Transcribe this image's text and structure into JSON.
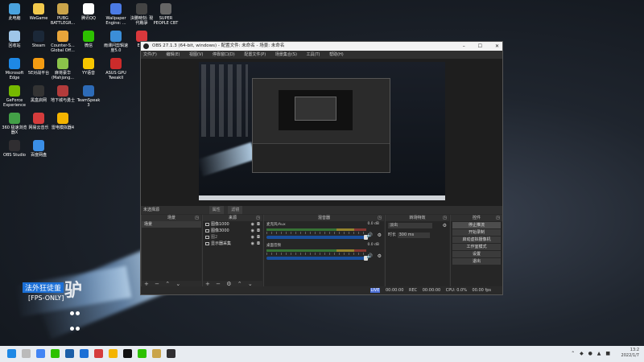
{
  "desktop": {
    "icons": [
      {
        "label": "此电脑",
        "color": "#4aa3df"
      },
      {
        "label": "WeGame",
        "color": "#f2c94c"
      },
      {
        "label": "PUBG BATTLEGR...",
        "color": "#caa44a"
      },
      {
        "label": "腾讯QQ",
        "color": "#ffffff"
      },
      {
        "label": "Wallpaper Engine: ...",
        "color": "#4b7be5"
      },
      {
        "label": "決勝時刻: 現代戰爭",
        "color": "#444444"
      },
      {
        "label": "SUPER PEOPLE CBT",
        "color": "#666666"
      },
      {
        "label": "回收站",
        "color": "#9fc6e8"
      },
      {
        "label": "Steam",
        "color": "#1b2838"
      },
      {
        "label": "Counter-S... Global Off...",
        "color": "#e8a53a"
      },
      {
        "label": "微信",
        "color": "#2dc100"
      },
      {
        "label": "雨课问剪辑速度5.0",
        "color": "#3b8ed8"
      },
      {
        "label": "Ep...",
        "color": "#d9383c"
      },
      {
        "label": "Microsoft Edge",
        "color": "#1e88e5"
      },
      {
        "label": "5E对战平台",
        "color": "#f39c12"
      },
      {
        "label": "麻将豪华 (Mahjong...",
        "color": "#8bc34a"
      },
      {
        "label": "YY语音",
        "color": "#f7c600"
      },
      {
        "label": "ASUS GPU TweakII",
        "color": "#cc2b2b"
      },
      {
        "label": "GeForce Experience",
        "color": "#76b900"
      },
      {
        "label": "黑盒启网",
        "color": "#333333"
      },
      {
        "label": "地下城与勇士",
        "color": "#b23b3b"
      },
      {
        "label": "TeamSpeak 3",
        "color": "#2d6bb7"
      },
      {
        "label": "360 极速浏览器X",
        "color": "#43a047"
      },
      {
        "label": "网易云音乐",
        "color": "#d53c3c"
      },
      {
        "label": "雷电模拟器4",
        "color": "#f4b400"
      },
      {
        "label": "英雄联盟",
        "color": "#1c5fa8"
      },
      {
        "label": "百度网盘",
        "color": "#3a8ee6"
      },
      {
        "label": "OBS Studio",
        "color": "#302e31"
      }
    ],
    "overlay_title": "法外狂徒董",
    "overlay_big": "驴",
    "overlay_fps": "[FPS-ONLY]"
  },
  "obs": {
    "title": "OBS 27.1.3 (64-bit, windows) - 配置文件: 未命名 - 场景: 未命名",
    "window_controls": [
      "–",
      "☐",
      "✕"
    ],
    "menu": [
      "文件(F)",
      "编辑(E)",
      "视图(V)",
      "停靠窗口(D)",
      "配置文件(P)",
      "场景集合(S)",
      "工具(T)",
      "帮助(H)"
    ],
    "scene_bar": {
      "label": "未选择源",
      "props": "属性",
      "filters": "滤镜"
    },
    "docks": {
      "scenes": {
        "title": "场景",
        "items": [
          "场景"
        ]
      },
      "sources": {
        "title": "来源",
        "items": [
          "图像1000",
          "图像3000",
          "图2",
          "显示器采集"
        ]
      },
      "mixer": {
        "title": "混音器",
        "channels": [
          {
            "name": "麦克风/Aux",
            "db": "0.0 dB"
          },
          {
            "name": "桌面音频",
            "db": "0.0 dB"
          }
        ]
      },
      "transitions": {
        "title": "转场特效",
        "type": "淡出",
        "duration_label": "时长",
        "duration": "300 ms"
      },
      "controls": {
        "title": "控件",
        "buttons": [
          "停止推流",
          "开始录制",
          "启动虚拟摄像机",
          "工作室模式",
          "设置",
          "退出"
        ]
      }
    },
    "status": {
      "live": "LIVE",
      "live_time": "00:00:00",
      "rec": "REC",
      "rec_time": "00:00:00",
      "cpu": "CPU: 0.0%",
      "fps": "00.00 fps"
    }
  },
  "taskbar": {
    "apps": [
      "#1e88e5",
      "#bbbbbb",
      "#4285f4",
      "#2dc100",
      "#1c5fa8",
      "#1b6fd6",
      "#d53c3c",
      "#f4b400",
      "#111111",
      "#2dc100",
      "#caa44a",
      "#302e31"
    ],
    "tray_time": "13:2",
    "tray_date": "2022/1/7"
  }
}
